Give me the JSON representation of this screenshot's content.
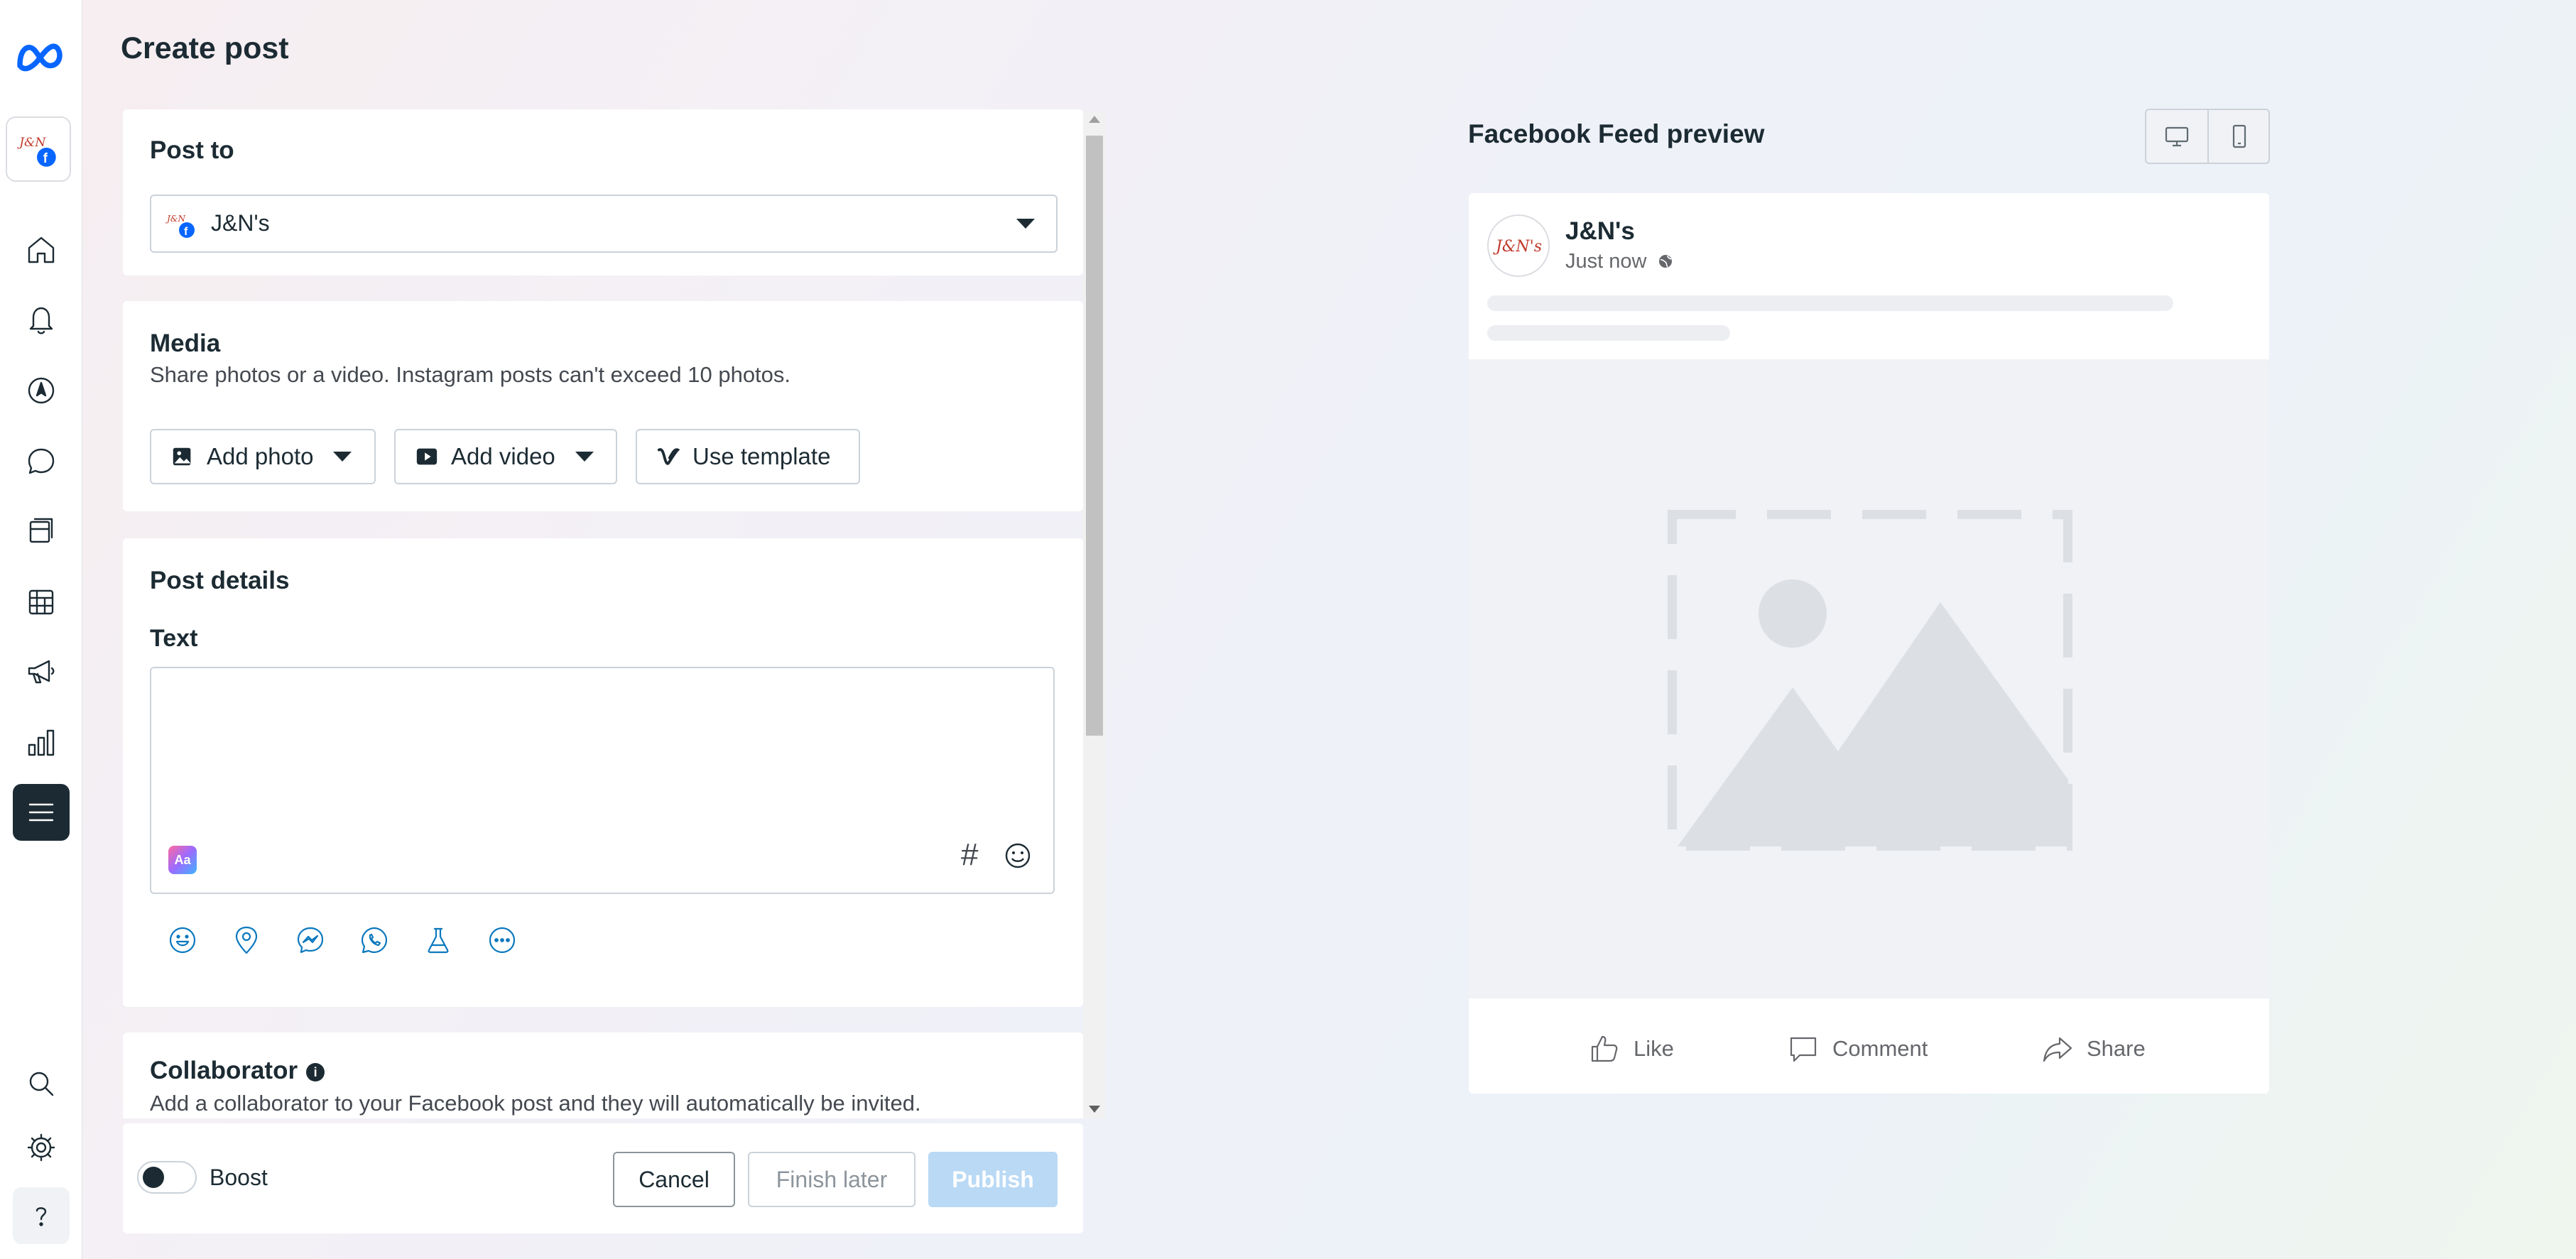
{
  "page": {
    "title": "Create post"
  },
  "sidebar": {
    "items": [
      {
        "icon": "meta-logo-icon"
      },
      {
        "icon": "account-avatar"
      },
      {
        "icon": "home-icon"
      },
      {
        "icon": "bell-icon"
      },
      {
        "icon": "compass-icon"
      },
      {
        "icon": "chat-icon"
      },
      {
        "icon": "content-icon"
      },
      {
        "icon": "calendar-table-icon"
      },
      {
        "icon": "megaphone-icon"
      },
      {
        "icon": "insights-icon"
      },
      {
        "icon": "menu-icon"
      },
      {
        "icon": "search-icon"
      },
      {
        "icon": "settings-icon"
      },
      {
        "icon": "help-icon"
      }
    ]
  },
  "post_to": {
    "title": "Post to",
    "selected": "J&N's"
  },
  "media": {
    "title": "Media",
    "subtitle": "Share photos or a video. Instagram posts can't exceed 10 photos.",
    "add_photo": "Add photo",
    "add_video": "Add video",
    "use_template": "Use template"
  },
  "post_details": {
    "title": "Post details",
    "text_label": "Text",
    "text_value": "",
    "hashtag_symbol": "#"
  },
  "collaborator": {
    "title": "Collaborator",
    "subtitle": "Add a collaborator to your Facebook post and they will automatically be invited.",
    "info_glyph": "i"
  },
  "footer": {
    "boost_label": "Boost",
    "boost_on": false,
    "cancel": "Cancel",
    "finish_later": "Finish later",
    "publish": "Publish"
  },
  "preview": {
    "title": "Facebook Feed preview",
    "page_name": "J&N's",
    "timestamp": "Just now",
    "actions": {
      "like": "Like",
      "comment": "Comment",
      "share": "Share"
    }
  },
  "colors": {
    "text_primary": "#1c2b33",
    "accent_blue": "#0a78be",
    "publish_disabled": "#b9d9f5",
    "facebook_blue": "#0866ff"
  }
}
